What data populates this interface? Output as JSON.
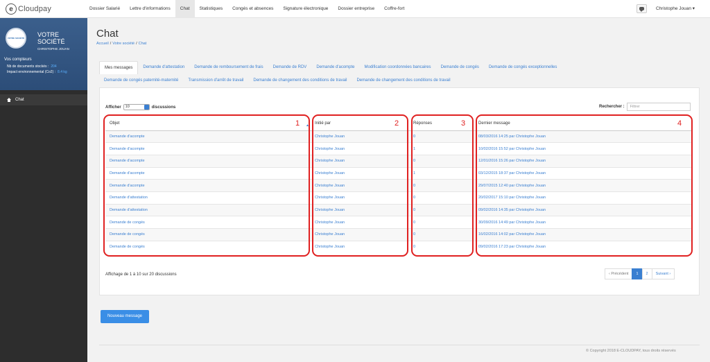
{
  "app": {
    "logo_letter": "e",
    "logo_text": "Cloudpay"
  },
  "nav": {
    "items": [
      "Dossier Salarié",
      "Lettre d'informations",
      "Chat",
      "Statistiques",
      "Congés et absences",
      "Signature électronique",
      "Dossier entreprise",
      "Coffre-fort"
    ],
    "active_index": 2,
    "user": "Christophe Jouan ▾"
  },
  "sidebar": {
    "company_line1": "VOTRE",
    "company_line2": "SOCIÉTÉ",
    "username": "CHRISTOPHE JOUAN",
    "avatar_text": "VOTRE SOCIÉTÉ",
    "counters_title": "Vos compteurs",
    "counters": [
      {
        "label": "Nb de documents stockés :",
        "value": "204"
      },
      {
        "label": "Impact environnemental (Co2) :",
        "value": "8.4 kg"
      }
    ],
    "menu_item": "Chat"
  },
  "page": {
    "title": "Chat",
    "breadcrumb": [
      "Accueil",
      "Votre société",
      "Chat"
    ]
  },
  "tabs": {
    "row1": [
      "Mes messages",
      "Demande d'attestation",
      "Demande de remboursement de frais",
      "Demande de RDV",
      "Demande d'acompte",
      "Modification coordonnées bancaires",
      "Demande de congés",
      "Demande de congés exceptionnelles"
    ],
    "row2": [
      "Demande de congés paternité-maternité",
      "Transmission d'arrêt de travail",
      "Demande de changement des conditions de travail",
      "Demande de changement des conditions de travail"
    ],
    "active": "Mes messages"
  },
  "table_controls": {
    "show_label": "Afficher",
    "show_value": "10",
    "show_suffix": "discussions",
    "search_label": "Rechercher :",
    "search_placeholder": "Filtrer"
  },
  "table": {
    "headers": [
      "Objet",
      "Initié par",
      "Réponses",
      "Dernier message"
    ],
    "rows": [
      [
        "Demande d'acompte",
        "Christophe Jouan",
        "0",
        "08/03/2016 14:25 par Christophe Jouan"
      ],
      [
        "Demande d'acompte",
        "Christophe Jouan",
        "1",
        "10/02/2016 15:52 par Christophe Jouan"
      ],
      [
        "Demande d'acompte",
        "Christophe Jouan",
        "0",
        "12/01/2016 15:26 par Christophe Jouan"
      ],
      [
        "Demande d'acompte",
        "Christophe Jouan",
        "1",
        "03/12/2015 18:37 par Christophe Jouan"
      ],
      [
        "Demande d'acompte",
        "Christophe Jouan",
        "0",
        "29/07/2015 12:40 par Christophe Jouan"
      ],
      [
        "Demande d'attestation",
        "Christophe Jouan",
        "0",
        "20/02/2017 15:10 par Christophe Jouan"
      ],
      [
        "Demande d'attestation",
        "Christophe Jouan",
        "0",
        "09/02/2016 14:35 par Christophe Jouan"
      ],
      [
        "Demande de congés",
        "Christophe Jouan",
        "0",
        "30/09/2016 14:49 par Christophe Jouan"
      ],
      [
        "Demande de congés",
        "Christophe Jouan",
        "0",
        "16/02/2016 14:02 par Christophe Jouan"
      ],
      [
        "Demande de congés",
        "Christophe Jouan",
        "0",
        "09/02/2016 17:23 par Christophe Jouan"
      ]
    ]
  },
  "annotations": [
    "1",
    "2",
    "3",
    "4"
  ],
  "info_text": "Affichage de 1 à 10 sur 20 discussions",
  "pagination": {
    "prev": "‹ Précédent",
    "pages": [
      "1",
      "2"
    ],
    "active": "1",
    "next": "Suivant ›"
  },
  "new_message_label": "Nouveau message",
  "footer": "© Copyright 2018 E-CLOUDPAY, tous droits réservés",
  "colors": {
    "link": "#3a7fd1",
    "annotation": "#e02020",
    "sidebar": "#2d2d2d",
    "sidebar_header": "#2c4d78"
  }
}
